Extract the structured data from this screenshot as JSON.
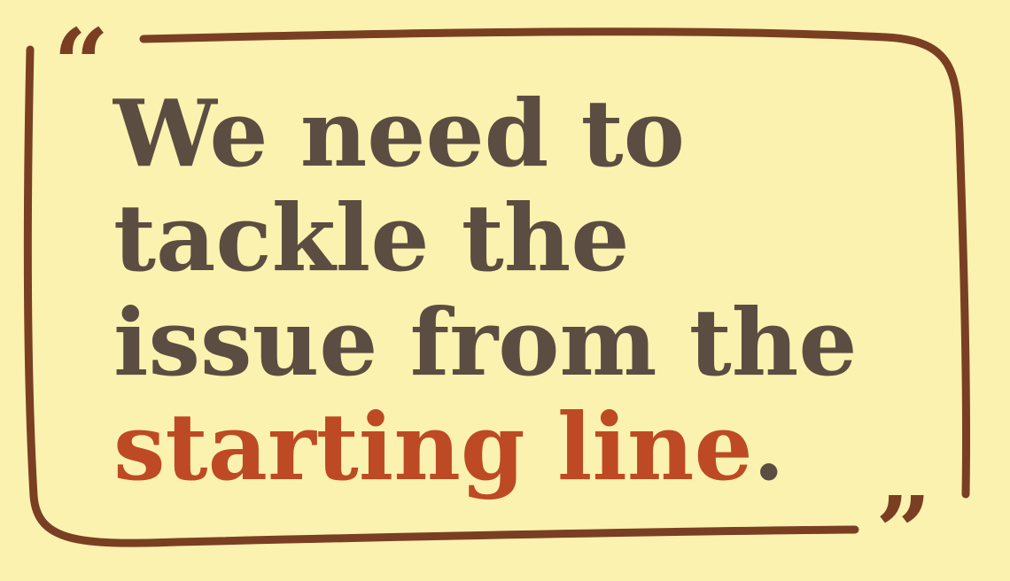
{
  "colors": {
    "background": "#fbf2b0",
    "frame": "#7a3f23",
    "text": "#5c4d42",
    "highlight": "#bd4a24"
  },
  "quote": {
    "open_mark": "“",
    "close_mark": "”",
    "lines": [
      "We need to",
      "tackle the",
      "issue from the"
    ],
    "last_line_highlight": "starting line",
    "last_line_end": "."
  }
}
